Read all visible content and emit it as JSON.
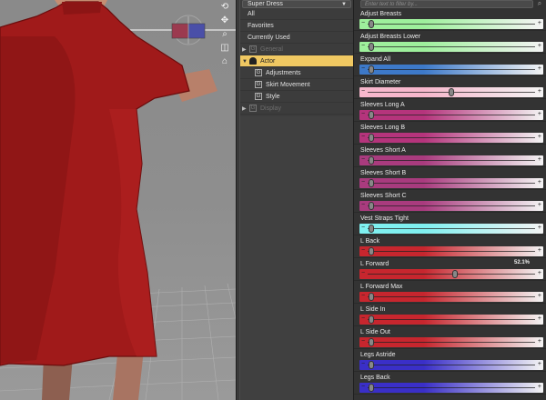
{
  "node_selector": {
    "value": "Super Dress"
  },
  "filter": {
    "placeholder": "Enter text to filter by..."
  },
  "tree": {
    "items": [
      {
        "label": "All"
      },
      {
        "label": "Favorites"
      },
      {
        "label": "Currently Used"
      },
      {
        "label": "General"
      },
      {
        "label": "Actor"
      },
      {
        "label": "Adjustments"
      },
      {
        "label": "Skirt Movement"
      },
      {
        "label": "Style"
      },
      {
        "label": "Display"
      }
    ]
  },
  "viewport": {
    "icons": [
      "camera-orbit-icon",
      "pan-icon",
      "zoom-icon",
      "frame-icon",
      "home-icon"
    ]
  },
  "properties": [
    {
      "label": "Adjust Breasts",
      "value": "",
      "level": 0.02,
      "color": "#9ef09c"
    },
    {
      "label": "Adjust Breasts Lower",
      "value": "",
      "level": 0.02,
      "color": "#9ef09c"
    },
    {
      "label": "Expand All",
      "value": "",
      "level": 0.02,
      "color": "#3d79c9"
    },
    {
      "label": "Skirt Diameter",
      "value": "",
      "level": 0.5,
      "color": "#f7b7cc"
    },
    {
      "label": "Sleeves Long A",
      "value": "",
      "level": 0.02,
      "color": "#b5347c"
    },
    {
      "label": "Sleeves Long B",
      "value": "",
      "level": 0.02,
      "color": "#b5347c"
    },
    {
      "label": "Sleeves Short A",
      "value": "",
      "level": 0.02,
      "color": "#a93b7e"
    },
    {
      "label": "Sleeves Short B",
      "value": "",
      "level": 0.02,
      "color": "#a93b7e"
    },
    {
      "label": "Sleeves Short C",
      "value": "",
      "level": 0.02,
      "color": "#a93b7e"
    },
    {
      "label": "Vest Straps Tight",
      "value": "",
      "level": 0.02,
      "color": "#7ff0f0"
    },
    {
      "label": "L Back",
      "value": "",
      "level": 0.02,
      "color": "#c7262e"
    },
    {
      "label": "L Forward",
      "value": "52.1%",
      "level": 0.52,
      "color": "#c7262e"
    },
    {
      "label": "L Forward Max",
      "value": "",
      "level": 0.02,
      "color": "#c7262e"
    },
    {
      "label": "L Side In",
      "value": "",
      "level": 0.02,
      "color": "#c7262e"
    },
    {
      "label": "L Side Out",
      "value": "",
      "level": 0.02,
      "color": "#c7262e"
    },
    {
      "label": "Legs Astride",
      "value": "",
      "level": 0.02,
      "color": "#3a2fc8"
    },
    {
      "label": "Legs Back",
      "value": "",
      "level": 0.02,
      "color": "#3a2fc8"
    }
  ],
  "colors": {
    "selection": "#f0c862",
    "dress": "#a01a1a"
  }
}
